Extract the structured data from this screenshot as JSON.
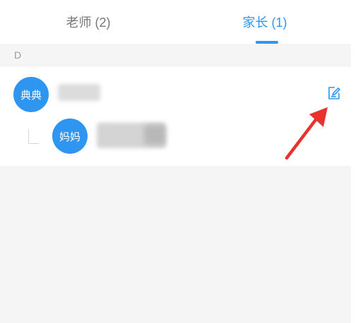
{
  "tabs": [
    {
      "label": "老师 (2)",
      "active": false
    },
    {
      "label": "家长 (1)",
      "active": true
    }
  ],
  "accent_color": "#2e96f0",
  "section": {
    "letter": "D"
  },
  "child": {
    "avatar_text": "典典"
  },
  "parent": {
    "avatar_text": "妈妈"
  },
  "icons": {
    "edit": "edit-icon",
    "annotation": "red-arrow"
  }
}
